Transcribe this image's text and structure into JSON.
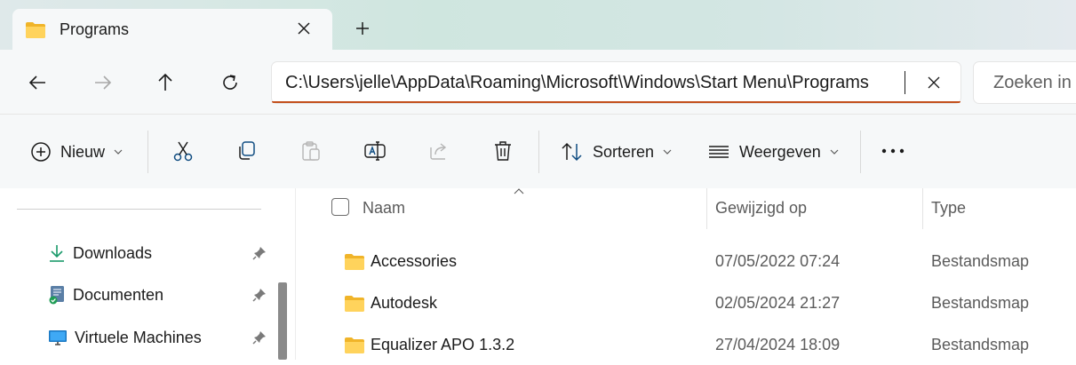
{
  "tab": {
    "title": "Programs"
  },
  "address": {
    "path": "C:\\Users\\jelle\\AppData\\Roaming\\Microsoft\\Windows\\Start Menu\\Programs",
    "search_placeholder": "Zoeken in"
  },
  "toolbar": {
    "new_label": "Nieuw",
    "sort_label": "Sorteren",
    "view_label": "Weergeven"
  },
  "sidebar": {
    "items": [
      {
        "label": "Downloads",
        "icon": "download-icon"
      },
      {
        "label": "Documenten",
        "icon": "documents-icon"
      },
      {
        "label": "Virtuele Machines",
        "icon": "monitor-icon"
      }
    ]
  },
  "columns": {
    "name": "Naam",
    "modified": "Gewijzigd op",
    "type": "Type"
  },
  "files": [
    {
      "name": "Accessories",
      "modified": "07/05/2022 07:24",
      "type": "Bestandsmap"
    },
    {
      "name": "Autodesk",
      "modified": "02/05/2024 21:27",
      "type": "Bestandsmap"
    },
    {
      "name": "Equalizer APO 1.3.2",
      "modified": "27/04/2024 18:09",
      "type": "Bestandsmap"
    }
  ],
  "colors": {
    "accent_underline": "#c3501c",
    "folder_yellow": "#f7c948"
  }
}
